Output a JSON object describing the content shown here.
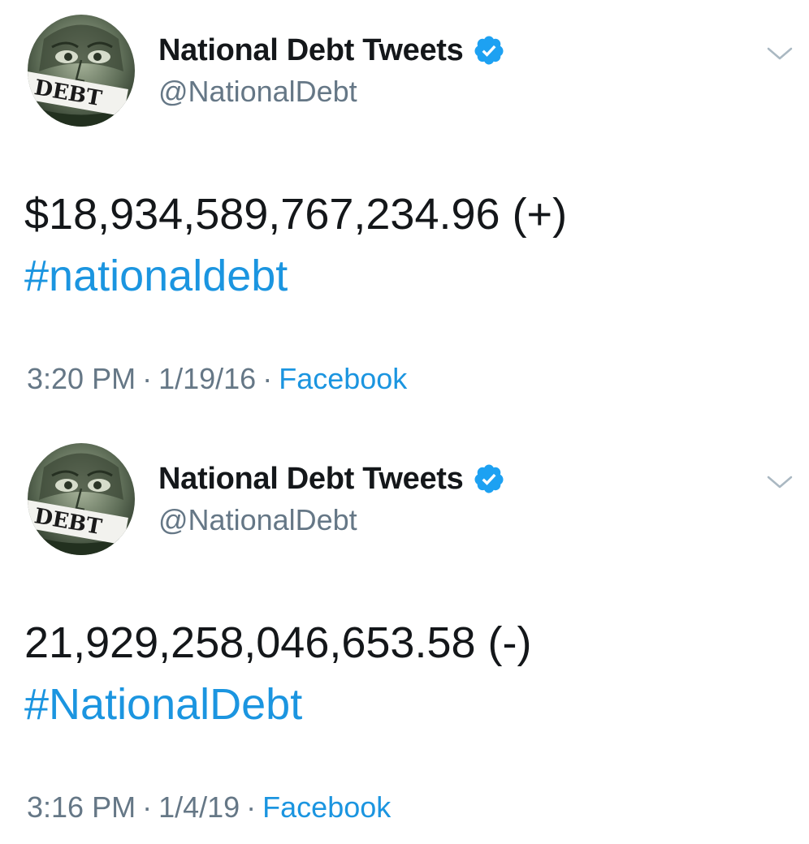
{
  "colors": {
    "text": "#14171a",
    "secondary": "#657786",
    "link": "#1b95e0",
    "verified": "#1da1f2"
  },
  "tweets": [
    {
      "display_name": "National Debt Tweets",
      "handle": "@NationalDebt",
      "avatar_label": "DEBT",
      "verified_icon": "verified-badge-icon",
      "menu_icon": "chevron-down-icon",
      "text": "$18,934,589,767,234.96 (+)",
      "hashtag": "#nationaldebt",
      "time": "3:20 PM",
      "date": "1/19/16",
      "separator": "·",
      "source": "Facebook"
    },
    {
      "display_name": "National Debt Tweets",
      "handle": "@NationalDebt",
      "avatar_label": "DEBT",
      "verified_icon": "verified-badge-icon",
      "menu_icon": "chevron-down-icon",
      "text": "21,929,258,046,653.58 (-)",
      "hashtag": "#NationalDebt",
      "time": "3:16 PM",
      "date": "1/4/19",
      "separator": "·",
      "source": "Facebook"
    }
  ]
}
